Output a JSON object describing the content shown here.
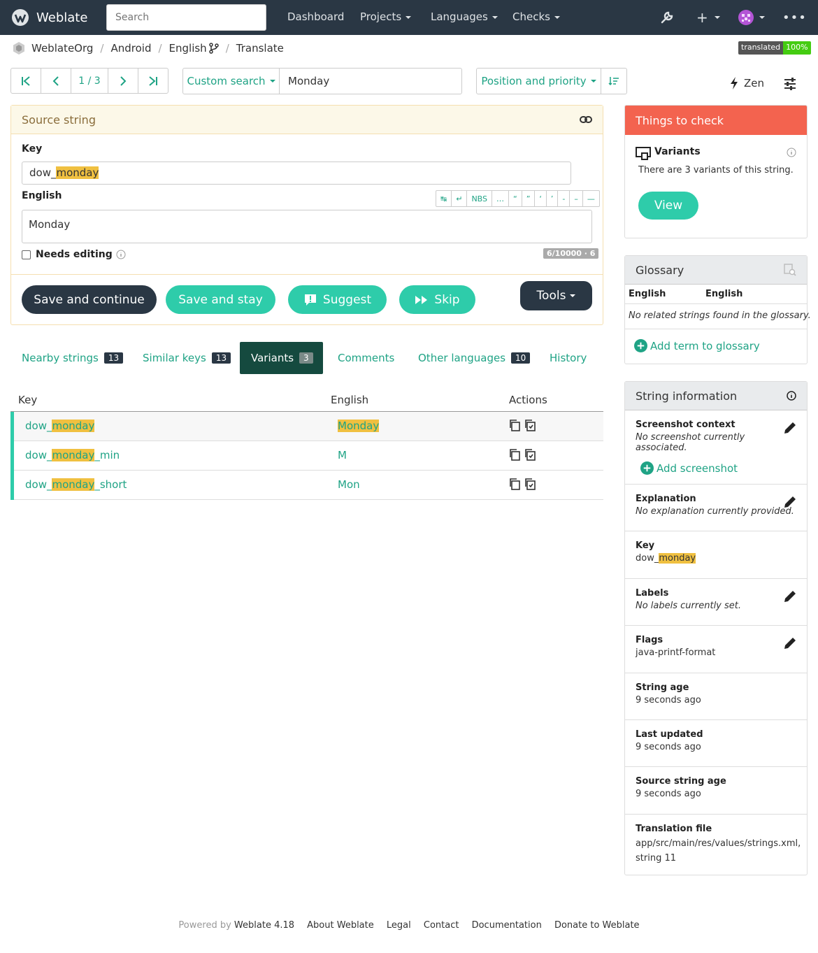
{
  "nav": {
    "brand": "Weblate",
    "search_placeholder": "Search",
    "items": [
      "Dashboard",
      "Projects",
      "Languages",
      "Checks"
    ]
  },
  "breadcrumb": [
    "WeblateOrg",
    "Android",
    "English",
    "Translate"
  ],
  "badge": {
    "label": "translated",
    "value": "100%"
  },
  "pager": {
    "position": "1 / 3"
  },
  "search": {
    "type_label": "Custom search",
    "query": "Monday"
  },
  "sort": {
    "label": "Position and priority"
  },
  "zen_label": "Zen",
  "source": {
    "title": "Source string",
    "key_label": "Key",
    "key_prefix": "dow_",
    "key_highlight": "monday",
    "lang_label": "English",
    "text": "Monday",
    "char_buttons": [
      "↹",
      "↵",
      "NBS",
      "…",
      "“",
      "”",
      "‘",
      "’",
      "-",
      "–",
      "—"
    ],
    "needs_editing_label": "Needs editing",
    "counter": "6/10000 · 6"
  },
  "buttons": {
    "save_continue": "Save and continue",
    "save_stay": "Save and stay",
    "suggest": "Suggest",
    "skip": "Skip",
    "tools": "Tools"
  },
  "tabs": [
    {
      "label": "Nearby strings",
      "count": "13"
    },
    {
      "label": "Similar keys",
      "count": "13"
    },
    {
      "label": "Variants",
      "count": "3"
    },
    {
      "label": "Comments"
    },
    {
      "label": "Other languages",
      "count": "10"
    },
    {
      "label": "History"
    }
  ],
  "table": {
    "headers": [
      "Key",
      "English",
      "Actions"
    ],
    "rows": [
      {
        "key_pre": "dow_",
        "key_hl": "monday",
        "key_post": "",
        "value": "Monday",
        "value_hl": true
      },
      {
        "key_pre": "dow_",
        "key_hl": "monday",
        "key_post": "_min",
        "value": "M",
        "value_hl": false
      },
      {
        "key_pre": "dow_",
        "key_hl": "monday",
        "key_post": "_short",
        "value": "Mon",
        "value_hl": false
      }
    ]
  },
  "checks": {
    "title": "Things to check",
    "item_title": "Variants",
    "item_text": "There are 3 variants of this string.",
    "view_label": "View"
  },
  "glossary": {
    "title": "Glossary",
    "col1": "English",
    "col2": "English",
    "empty": "No related strings found in the glossary.",
    "add_label": "Add term to glossary"
  },
  "info": {
    "title": "String information",
    "screenshot_title": "Screenshot context",
    "screenshot_text": "No screenshot currently associated.",
    "add_screenshot": "Add screenshot",
    "explanation_title": "Explanation",
    "explanation_text": "No explanation currently provided.",
    "key_title": "Key",
    "key_pre": "dow_",
    "key_hl": "monday",
    "labels_title": "Labels",
    "labels_text": "No labels currently set.",
    "flags_title": "Flags",
    "flags_text": "java-printf-format",
    "age_title": "String age",
    "age_text": "9 seconds ago",
    "updated_title": "Last updated",
    "updated_text": "9 seconds ago",
    "source_age_title": "Source string age",
    "source_age_text": "9 seconds ago",
    "file_title": "Translation file",
    "file_text": "app/src/main/res/values/strings.xml, string 11"
  },
  "footer": {
    "powered": "Powered by",
    "version": "Weblate 4.18",
    "links": [
      "About Weblate",
      "Legal",
      "Contact",
      "Documentation",
      "Donate to Weblate"
    ]
  },
  "colors": {
    "navbar": "#2a3744",
    "accent": "#2eccaa",
    "link": "#1fa385",
    "check": "#f3634f",
    "highlight": "#f0c040"
  }
}
